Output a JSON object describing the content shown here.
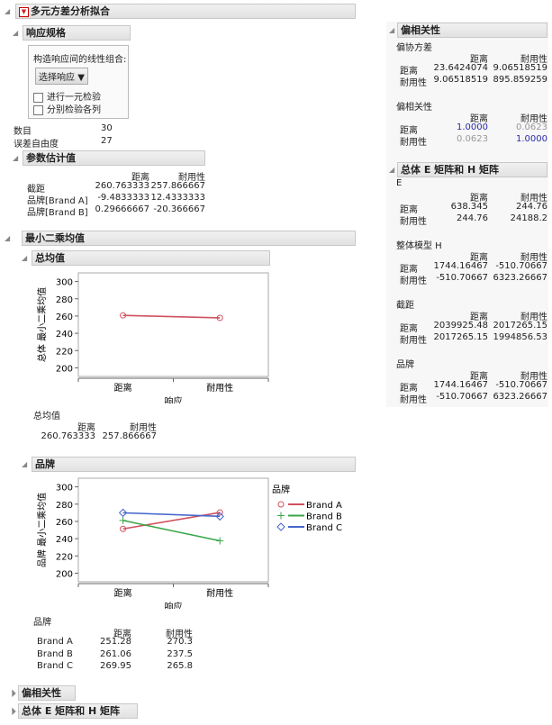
{
  "title": "多元方差分析拟合",
  "response_spec": {
    "header": "响应规格",
    "prompt": "构造响应间的线性组合:",
    "select_label": "选择响应",
    "check1": "进行一元检验",
    "check2": "分别检验各列"
  },
  "stats": {
    "n_label": "数目",
    "n_value": "30",
    "df_label": "误差自由度",
    "df_value": "27"
  },
  "param": {
    "header": "参数估计值",
    "cols": [
      "距离",
      "耐用性"
    ],
    "rows": [
      {
        "label": "截距",
        "v": [
          "260.763333",
          "257.866667"
        ]
      },
      {
        "label": "品牌[Brand A]",
        "v": [
          "-9.4833333",
          "12.4333333"
        ]
      },
      {
        "label": "品牌[Brand B]",
        "v": [
          "0.29666667",
          "-20.366667"
        ]
      }
    ]
  },
  "lsm": {
    "header": "最小二乘均值",
    "grand": {
      "header": "总均值",
      "table_title": "总均值",
      "cols": [
        "距离",
        "耐用性"
      ],
      "values": [
        "260.763333",
        "257.866667"
      ]
    },
    "brand": {
      "header": "品牌",
      "table_title": "品牌",
      "cols": [
        "距离",
        "耐用性"
      ],
      "rows": [
        {
          "label": "Brand A",
          "v": [
            "251.28",
            "270.3"
          ]
        },
        {
          "label": "Brand B",
          "v": [
            "261.06",
            "237.5"
          ]
        },
        {
          "label": "Brand C",
          "v": [
            "269.95",
            "265.8"
          ]
        }
      ]
    }
  },
  "chart_data": [
    {
      "type": "line",
      "categories": [
        "距离",
        "耐用性"
      ],
      "xlabel": "响应",
      "ylabel": "总体 最小二乘均值",
      "ylim": [
        190,
        310
      ],
      "yticks": [
        200,
        220,
        240,
        260,
        280,
        300
      ],
      "series": [
        {
          "values": [
            260.763333,
            257.866667
          ],
          "color": "#d0505e",
          "marker": "circle"
        }
      ]
    },
    {
      "type": "line",
      "categories": [
        "距离",
        "耐用性"
      ],
      "xlabel": "响应",
      "ylabel": "品牌 最小二乘均值",
      "ylim": [
        190,
        310
      ],
      "yticks": [
        200,
        220,
        240,
        260,
        280,
        300
      ],
      "legend_title": "品牌",
      "legend": "right",
      "series": [
        {
          "name": "Brand A",
          "values": [
            251.28,
            270.3
          ],
          "color": "#d0505e",
          "marker": "circle"
        },
        {
          "name": "Brand B",
          "values": [
            261.06,
            237.5
          ],
          "color": "#3aa64a",
          "marker": "plus"
        },
        {
          "name": "Brand C",
          "values": [
            269.95,
            265.8
          ],
          "color": "#4466cc",
          "marker": "diamond"
        }
      ]
    }
  ],
  "collapsed": [
    "偏相关性",
    "总体 E 矩阵和 H 矩阵"
  ],
  "partial": {
    "header": "偏相关性",
    "cov_title": "偏协方差",
    "cols": [
      "距离",
      "耐用性"
    ],
    "cov": [
      {
        "label": "距离",
        "v": [
          "23.6424074",
          "9.06518519"
        ]
      },
      {
        "label": "耐用性",
        "v": [
          "9.06518519",
          "895.859259"
        ]
      }
    ],
    "corr_title": "偏相关性",
    "corr": [
      {
        "label": "距离",
        "v": [
          "1.0000",
          "0.0623"
        ]
      },
      {
        "label": "耐用性",
        "v": [
          "0.0623",
          "1.0000"
        ]
      }
    ]
  },
  "eh": {
    "header": "总体 E 矩阵和 H 矩阵",
    "cols": [
      "距离",
      "耐用性"
    ],
    "mats": [
      {
        "title": "E",
        "rows": [
          {
            "label": "距离",
            "v": [
              "638.345",
              "244.76"
            ]
          },
          {
            "label": "耐用性",
            "v": [
              "244.76",
              "24188.2"
            ]
          }
        ]
      },
      {
        "title": "整体模型 H",
        "rows": [
          {
            "label": "距离",
            "v": [
              "1744.16467",
              "-510.70667"
            ]
          },
          {
            "label": "耐用性",
            "v": [
              "-510.70667",
              "6323.26667"
            ]
          }
        ]
      },
      {
        "title": "截距",
        "rows": [
          {
            "label": "距离",
            "v": [
              "2039925.48",
              "2017265.15"
            ]
          },
          {
            "label": "耐用性",
            "v": [
              "2017265.15",
              "1994856.53"
            ]
          }
        ]
      },
      {
        "title": "品牌",
        "rows": [
          {
            "label": "距离",
            "v": [
              "1744.16467",
              "-510.70667"
            ]
          },
          {
            "label": "耐用性",
            "v": [
              "-510.70667",
              "6323.26667"
            ]
          }
        ]
      }
    ]
  },
  "colors": {
    "red_triangle": "#d0202a",
    "corr_diag": "#2a2aa8"
  }
}
